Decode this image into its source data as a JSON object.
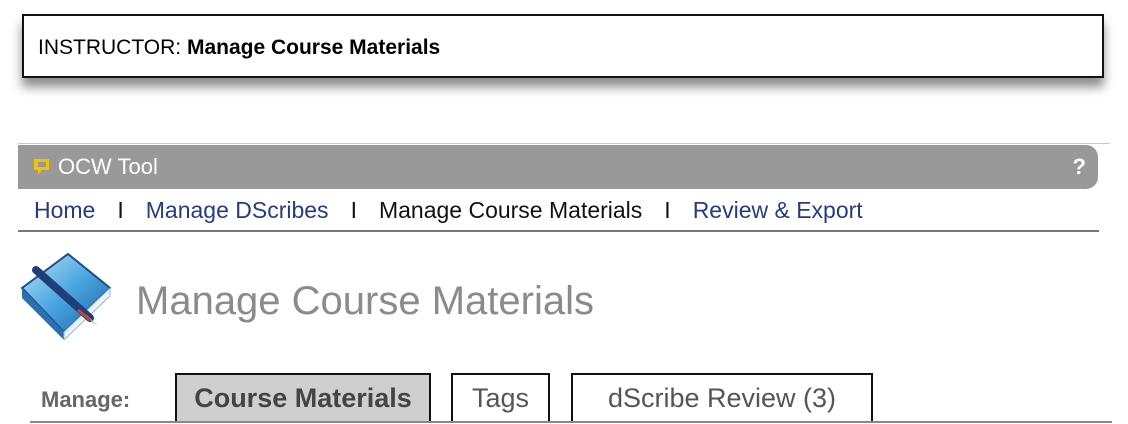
{
  "header": {
    "role": "INSTRUCTOR:",
    "title": "Manage Course Materials"
  },
  "toolbar": {
    "title": "OCW Tool",
    "help": "?",
    "logo_icon": "ocw-logo-icon"
  },
  "nav": {
    "items": [
      {
        "label": "Home"
      },
      {
        "label": "Manage DScribes"
      },
      {
        "label": "Manage Course Materials"
      },
      {
        "label": "Review & Export"
      }
    ],
    "separator": "I"
  },
  "page": {
    "title": "Manage Course Materials",
    "icon": "book-pen-icon"
  },
  "tabs": {
    "label": "Manage:",
    "items": [
      {
        "label": "Course Materials",
        "active": true
      },
      {
        "label": "Tags",
        "active": false
      },
      {
        "label": "dScribe Review (3)",
        "active": false
      }
    ]
  },
  "colors": {
    "toolbar_bg": "#999999",
    "link": "#253c84",
    "title_gray": "#8b8b8b",
    "active_tab": "#cfcfcf",
    "logo_yellow": "#f2c200"
  }
}
